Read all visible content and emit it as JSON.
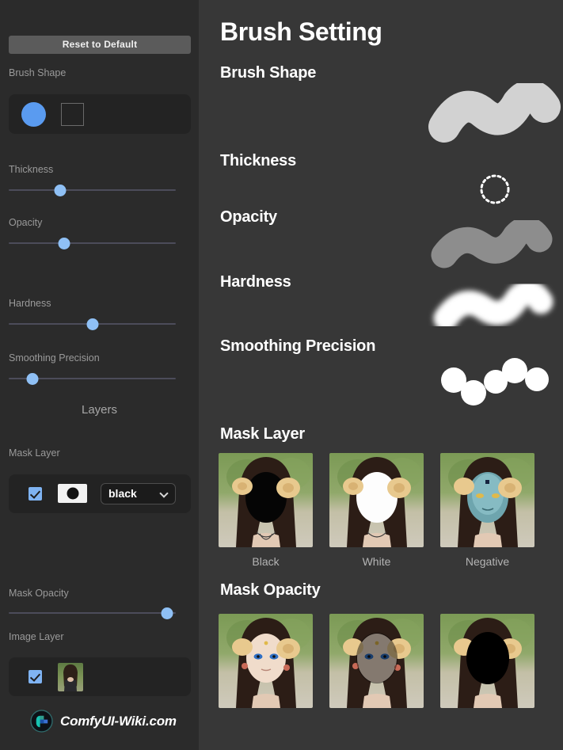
{
  "window": {
    "title": "Brush Setting"
  },
  "sidebar": {
    "reset_label": "Reset to Default",
    "brush_shape_label": "Brush Shape",
    "shape_options": [
      "circle",
      "square"
    ],
    "selected_shape": "circle",
    "sliders": [
      {
        "label": "Thickness",
        "value": 31
      },
      {
        "label": "Opacity",
        "value": 33
      },
      {
        "label": "Hardness",
        "value": 50
      },
      {
        "label": "Smoothing Precision",
        "value": 14
      }
    ],
    "layers_heading": "Layers",
    "mask_layer_label": "Mask Layer",
    "mask_layer": {
      "enabled": true,
      "mode_value": "black",
      "mode_options": [
        "black",
        "white",
        "negative"
      ]
    },
    "mask_opacity_label": "Mask Opacity",
    "mask_opacity_value": 95,
    "image_layer_label": "Image Layer",
    "image_layer": {
      "enabled": true
    },
    "watermark": "ComfyUI-Wiki.com"
  },
  "main": {
    "title": "Brush Setting",
    "sections": [
      {
        "id": "brush-shape",
        "title": "Brush Shape",
        "left_demo": "round-cap-stroke",
        "right_demo": "square-cap-stroke"
      },
      {
        "id": "thickness",
        "title": "Thickness",
        "left_demo": "small-dotted-cursor-circle",
        "right_demo": "large-dotted-cursor-circle"
      },
      {
        "id": "opacity",
        "title": "Opacity",
        "left_demo": "stroke-high-opacity",
        "right_demo": "stroke-low-opacity"
      },
      {
        "id": "hardness",
        "title": "Hardness",
        "left_demo": "stroke-soft-edge",
        "right_demo": "stroke-hard-edge"
      },
      {
        "id": "smoothing-precision",
        "title": "Smoothing Precision",
        "left_demo": "stroke-low-precision-dots",
        "right_demo": "stroke-high-precision-smooth"
      },
      {
        "id": "mask-layer",
        "title": "Mask Layer"
      },
      {
        "id": "mask-opacity",
        "title": "Mask Opacity"
      }
    ],
    "mask_layer_captions": [
      "Black",
      "White",
      "Negative"
    ]
  },
  "colors": {
    "panel_left_bg": "#2b2b2b",
    "panel_right_bg": "#373737",
    "accent_blue": "#5a9bf0",
    "slider_thumb": "#8fc0f5",
    "checkbox": "#7fb3f2",
    "reset_button": "#5b5b5b",
    "stroke_light": "#d4d4d4",
    "stroke_mid": "#8d8d8d",
    "stroke_white": "#ffffff"
  }
}
